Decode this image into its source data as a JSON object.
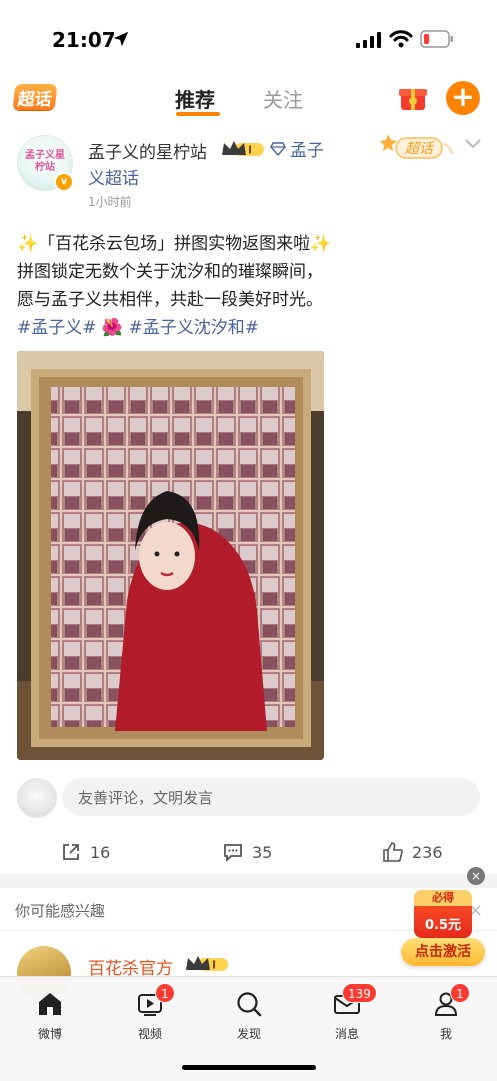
{
  "status_bar": {
    "time": "21:07"
  },
  "top_nav": {
    "brand_label": "超话",
    "tabs": [
      {
        "label": "推荐",
        "active": true
      },
      {
        "label": "关注",
        "active": false
      }
    ],
    "accent_color": "#ff8200"
  },
  "post": {
    "author": "孟子义的星柠站",
    "avatar_text": "孟子义星柠站",
    "level_badge": "I",
    "topic_line1": "孟子",
    "topic_line2": "义超话",
    "time": "1小时前",
    "chaohua_badge": "超话",
    "text": {
      "line1_sparkle_left": "✨",
      "line1": "「百花杀云包场」拼图实物返图来啦",
      "line1_sparkle_right": "✨",
      "line2": "拼图锁定无数个关于沈汐和的璀璨瞬间，",
      "line3": "愿与孟子义共相伴，共赴一段美好时光。",
      "hashtag1": "#孟子义#",
      "flower": "🌺",
      "hashtag2": "#孟子义沈汐和#"
    },
    "image_alt": "framed jigsaw puzzle photo collage",
    "comment_placeholder": "友善评论，文明发言",
    "actions": {
      "share": "16",
      "comments": "35",
      "likes": "236"
    }
  },
  "suggestions": {
    "title": "你可能感兴趣",
    "close": "×",
    "account_name": "百花杀官方",
    "level_badge": "I"
  },
  "red_packet": {
    "close": "×",
    "tag": "必得",
    "amount": "0.5元",
    "button": "点击激活"
  },
  "tab_bar": {
    "items": [
      {
        "label": "微博",
        "badge": ""
      },
      {
        "label": "视频",
        "badge": "1"
      },
      {
        "label": "发现",
        "badge": ""
      },
      {
        "label": "消息",
        "badge": "139"
      },
      {
        "label": "我",
        "badge": "1"
      }
    ]
  },
  "colors": {
    "accent": "#ff8200",
    "link": "#46639e",
    "badge_red": "#ff3a30"
  }
}
